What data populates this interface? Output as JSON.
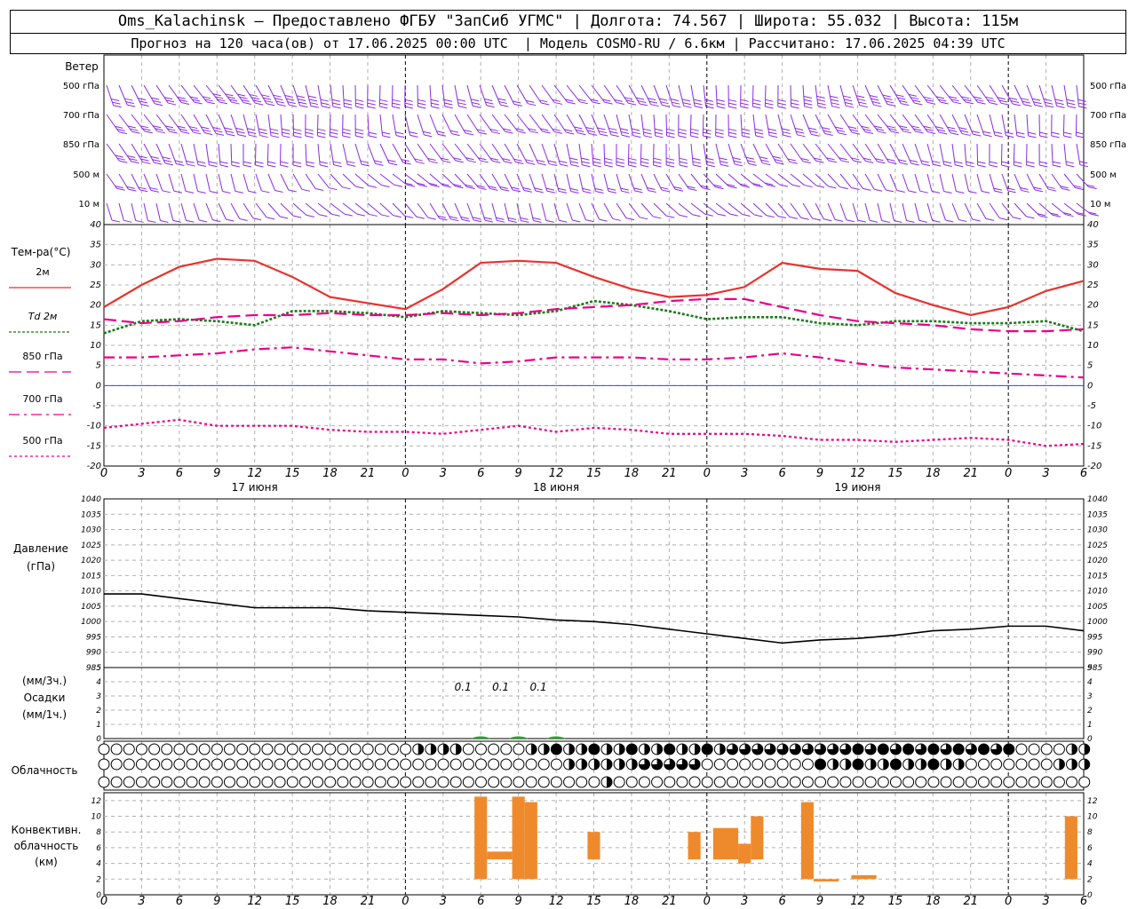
{
  "header": {
    "line1": "Oms_Kalachinsk – Предоставлено ФГБУ \"ЗапСиб УГМС\" | Долгота: 74.567 | Широта: 55.032 | Высота: 115м",
    "line2": "Прогноз на 120 часа(ов) от 17.06.2025 00:00 UTC  | Модель COSMO-RU / 6.6км | Рассчитано: 17.06.2025 04:39 UTC"
  },
  "panels": {
    "wind": {
      "title": "Ветер",
      "levels": [
        "500 гПа",
        "700 гПа",
        "850 гПа",
        "500 м",
        "10 м"
      ],
      "color": "#8a2be2"
    },
    "temperature": {
      "title": "Тем-ра(°C)",
      "legend": [
        {
          "label": "2м",
          "color": "#e8322e",
          "style": "solid"
        },
        {
          "label": "Td 2м",
          "color": "#1a7a1a",
          "style": "dotted"
        },
        {
          "label": "850 гПа",
          "color": "#e8008a",
          "style": "longdash"
        },
        {
          "label": "700 гПа",
          "color": "#e8008a",
          "style": "dashdot"
        },
        {
          "label": "500 гПа",
          "color": "#e8008a",
          "style": "dotted"
        }
      ]
    },
    "pressure": {
      "title": "Давление",
      "unit": "(гПа)"
    },
    "precip": {
      "unit_top": "(мм/3ч.)",
      "title": "Осадки",
      "unit_bottom": "(мм/1ч.)",
      "labels": [
        "0.1",
        "0.1",
        "0.1"
      ]
    },
    "cloud": {
      "title": "Облачность"
    },
    "convective": {
      "line1": "Конвективн.",
      "line2": "облачность",
      "line3": "(км)"
    }
  },
  "x_axis": {
    "hour_labels": [
      "0",
      "3",
      "6",
      "9",
      "12",
      "15",
      "18",
      "21",
      "0",
      "3",
      "6",
      "9",
      "12",
      "15",
      "18",
      "21",
      "0",
      "3",
      "6",
      "9",
      "12",
      "15",
      "18",
      "21",
      "0",
      "3",
      "6"
    ],
    "day_labels": [
      "17 июня",
      "18 июня",
      "19 июня"
    ]
  },
  "chart_data": [
    {
      "type": "line",
      "title": "Тем-ра(°C)",
      "x_hours": [
        0,
        3,
        6,
        9,
        12,
        15,
        18,
        21,
        24,
        27,
        30,
        33,
        36,
        39,
        42,
        45,
        48,
        51,
        54,
        57,
        60,
        63,
        66,
        69,
        72,
        75,
        78
      ],
      "ylim": [
        -20,
        40
      ],
      "yticks": [
        -20,
        -15,
        -10,
        -5,
        0,
        5,
        10,
        15,
        20,
        25,
        30,
        35,
        40
      ],
      "series": [
        {
          "name": "2м",
          "values": [
            19.5,
            25,
            29.5,
            31.5,
            31,
            27,
            22,
            20.5,
            19,
            24,
            30.5,
            31,
            30.5,
            27,
            24,
            22,
            22.5,
            24.5,
            30.5,
            29,
            28.5,
            23,
            20,
            17.5,
            19.5,
            23.5,
            26
          ]
        },
        {
          "name": "Td 2м",
          "values": [
            13,
            16,
            16.5,
            16,
            15,
            18.5,
            18.5,
            18,
            17,
            18.5,
            18,
            17.5,
            18.5,
            21,
            20,
            18.5,
            16.5,
            17,
            17,
            15.5,
            15,
            16,
            16,
            15.5,
            15.5,
            16,
            13.5
          ]
        },
        {
          "name": "850 гПа",
          "values": [
            16.5,
            15.5,
            16,
            17,
            17.5,
            17.5,
            18,
            17.5,
            17.5,
            18,
            17.5,
            18,
            19,
            19.5,
            20,
            21,
            21.5,
            21.5,
            19.5,
            17.5,
            16,
            15.5,
            15,
            14,
            13.5,
            13.5,
            14
          ]
        },
        {
          "name": "700 гПа",
          "values": [
            7,
            7,
            7.5,
            8,
            9,
            9.5,
            8.5,
            7.5,
            6.5,
            6.5,
            5.5,
            6,
            7,
            7,
            7,
            6.5,
            6.5,
            7,
            8,
            7,
            5.5,
            4.5,
            4,
            3.5,
            3,
            2.5,
            2
          ]
        },
        {
          "name": "500 гПа",
          "values": [
            -10.5,
            -9.5,
            -8.5,
            -10,
            -10,
            -10,
            -11,
            -11.5,
            -11.5,
            -12,
            -11,
            -10,
            -11.5,
            -10.5,
            -11,
            -12,
            -12,
            -12,
            -12.5,
            -13.5,
            -13.5,
            -14,
            -13.5,
            -13,
            -13.5,
            -15,
            -14.5
          ]
        }
      ]
    },
    {
      "type": "line",
      "title": "Давление",
      "x_hours": [
        0,
        3,
        6,
        9,
        12,
        15,
        18,
        21,
        24,
        27,
        30,
        33,
        36,
        39,
        42,
        45,
        48,
        51,
        54,
        57,
        60,
        63,
        66,
        69,
        72,
        75,
        78
      ],
      "ylim": [
        985,
        1040
      ],
      "yticks": [
        985,
        990,
        995,
        1000,
        1005,
        1010,
        1015,
        1020,
        1025,
        1030,
        1035,
        1040
      ],
      "series": [
        {
          "values": [
            1009,
            1009,
            1007.5,
            1006,
            1004.5,
            1004.5,
            1004.5,
            1003.5,
            1003,
            1002.5,
            1002,
            1001.5,
            1000.5,
            1000,
            999,
            997.5,
            996,
            994.5,
            993,
            994,
            994.5,
            995.5,
            997,
            997.5,
            998.5,
            998.5,
            997
          ]
        }
      ]
    },
    {
      "type": "bar",
      "title": "Осадки",
      "ylim": [
        0,
        5
      ],
      "yticks": [
        0,
        1,
        2,
        3,
        4,
        5
      ],
      "x_hours": [
        30,
        33,
        36
      ],
      "values": [
        0.1,
        0.1,
        0.1
      ]
    },
    {
      "type": "bar",
      "title": "Конвективн. облачность",
      "ylim": [
        0,
        13
      ],
      "yticks": [
        0,
        2,
        4,
        6,
        8,
        10,
        12
      ],
      "bars": [
        {
          "x0": 29.5,
          "x1": 30.5,
          "base": 2,
          "top": 12.5
        },
        {
          "x0": 30.5,
          "x1": 32.5,
          "base": 4.5,
          "top": 5.5
        },
        {
          "x0": 32.5,
          "x1": 33.5,
          "base": 2,
          "top": 12.5
        },
        {
          "x0": 33.5,
          "x1": 34.5,
          "base": 2,
          "top": 11.8
        },
        {
          "x0": 38.5,
          "x1": 39.5,
          "base": 4.5,
          "top": 8
        },
        {
          "x0": 46.5,
          "x1": 47.5,
          "base": 4.5,
          "top": 8
        },
        {
          "x0": 48.5,
          "x1": 50.5,
          "base": 4.5,
          "top": 8.5
        },
        {
          "x0": 50.5,
          "x1": 51.5,
          "base": 4,
          "top": 6.5
        },
        {
          "x0": 51.5,
          "x1": 52.5,
          "base": 4.5,
          "top": 10
        },
        {
          "x0": 55.5,
          "x1": 56.5,
          "base": 2,
          "top": 11.8
        },
        {
          "x0": 56.5,
          "x1": 58.5,
          "base": 1.7,
          "top": 2
        },
        {
          "x0": 59.5,
          "x1": 61.5,
          "base": 2,
          "top": 2.5
        },
        {
          "x0": 76.5,
          "x1": 77.5,
          "base": 2,
          "top": 10
        }
      ]
    }
  ],
  "colors": {
    "wind": "#8a2be2",
    "temp_2m": "#e8322e",
    "dewpoint": "#1a7a1a",
    "magenta": "#e8008a",
    "zero_line": "#3344ff",
    "convective": "#ef8a2c",
    "precip": "#22aa22"
  }
}
